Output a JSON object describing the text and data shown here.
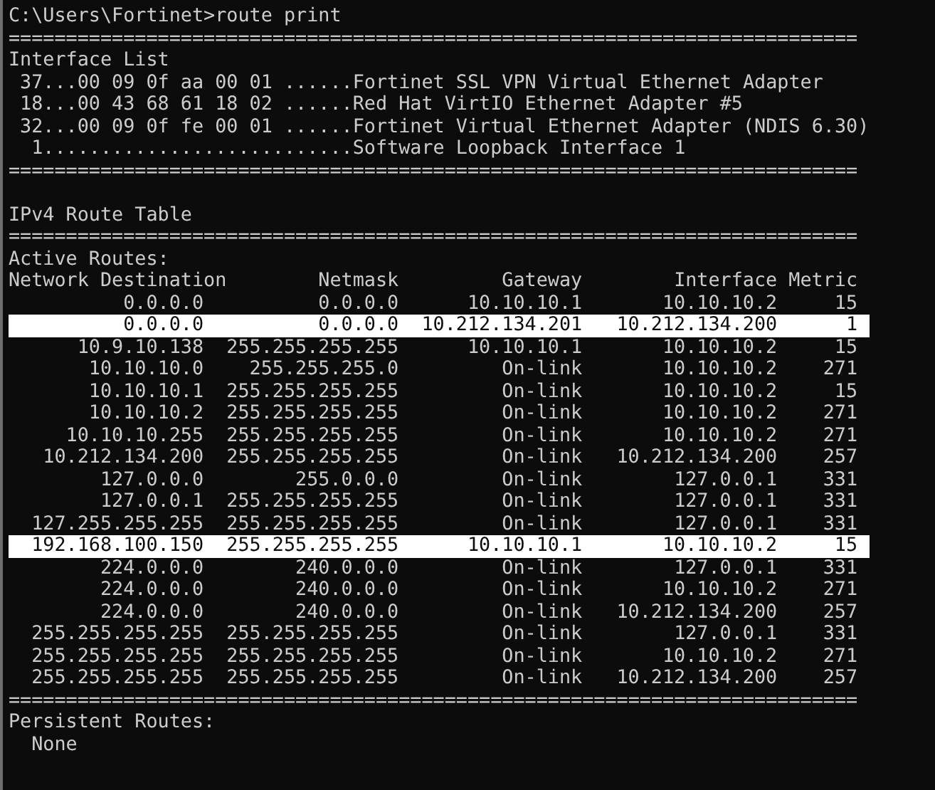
{
  "prompt": "C:\\Users\\Fortinet>route print",
  "interface_list": {
    "rule_top": "==========================================================================",
    "title": "Interface List",
    "interfaces": [
      " 37...00 09 0f aa 00 01 ......Fortinet SSL VPN Virtual Ethernet Adapter",
      " 18...00 43 68 61 18 02 ......Red Hat VirtIO Ethernet Adapter #5",
      " 32...00 09 0f fe 00 01 ......Fortinet Virtual Ethernet Adapter (NDIS 6.30)",
      "  1...........................Software Loopback Interface 1"
    ],
    "rule_bottom": "=========================================================================="
  },
  "route_table": {
    "title": "IPv4 Route Table",
    "rule_top": "==========================================================================",
    "subtitle": "Active Routes:",
    "columns": [
      "Network Destination",
      "Netmask",
      "Gateway",
      "Interface",
      "Metric"
    ],
    "routes": [
      {
        "destination": "0.0.0.0",
        "netmask": "0.0.0.0",
        "gateway": "10.10.10.1",
        "interface": "10.10.10.2",
        "metric": "15",
        "highlighted": false
      },
      {
        "destination": "0.0.0.0",
        "netmask": "0.0.0.0",
        "gateway": "10.212.134.201",
        "interface": "10.212.134.200",
        "metric": "1",
        "highlighted": true
      },
      {
        "destination": "10.9.10.138",
        "netmask": "255.255.255.255",
        "gateway": "10.10.10.1",
        "interface": "10.10.10.2",
        "metric": "15",
        "highlighted": false
      },
      {
        "destination": "10.10.10.0",
        "netmask": "255.255.255.0",
        "gateway": "On-link",
        "interface": "10.10.10.2",
        "metric": "271",
        "highlighted": false
      },
      {
        "destination": "10.10.10.1",
        "netmask": "255.255.255.255",
        "gateway": "On-link",
        "interface": "10.10.10.2",
        "metric": "15",
        "highlighted": false
      },
      {
        "destination": "10.10.10.2",
        "netmask": "255.255.255.255",
        "gateway": "On-link",
        "interface": "10.10.10.2",
        "metric": "271",
        "highlighted": false
      },
      {
        "destination": "10.10.10.255",
        "netmask": "255.255.255.255",
        "gateway": "On-link",
        "interface": "10.10.10.2",
        "metric": "271",
        "highlighted": false
      },
      {
        "destination": "10.212.134.200",
        "netmask": "255.255.255.255",
        "gateway": "On-link",
        "interface": "10.212.134.200",
        "metric": "257",
        "highlighted": false
      },
      {
        "destination": "127.0.0.0",
        "netmask": "255.0.0.0",
        "gateway": "On-link",
        "interface": "127.0.0.1",
        "metric": "331",
        "highlighted": false
      },
      {
        "destination": "127.0.0.1",
        "netmask": "255.255.255.255",
        "gateway": "On-link",
        "interface": "127.0.0.1",
        "metric": "331",
        "highlighted": false
      },
      {
        "destination": "127.255.255.255",
        "netmask": "255.255.255.255",
        "gateway": "On-link",
        "interface": "127.0.0.1",
        "metric": "331",
        "highlighted": false
      },
      {
        "destination": "192.168.100.150",
        "netmask": "255.255.255.255",
        "gateway": "10.10.10.1",
        "interface": "10.10.10.2",
        "metric": "15",
        "highlighted": true
      },
      {
        "destination": "224.0.0.0",
        "netmask": "240.0.0.0",
        "gateway": "On-link",
        "interface": "127.0.0.1",
        "metric": "331",
        "highlighted": false
      },
      {
        "destination": "224.0.0.0",
        "netmask": "240.0.0.0",
        "gateway": "On-link",
        "interface": "10.10.10.2",
        "metric": "271",
        "highlighted": false
      },
      {
        "destination": "224.0.0.0",
        "netmask": "240.0.0.0",
        "gateway": "On-link",
        "interface": "10.212.134.200",
        "metric": "257",
        "highlighted": false
      },
      {
        "destination": "255.255.255.255",
        "netmask": "255.255.255.255",
        "gateway": "On-link",
        "interface": "127.0.0.1",
        "metric": "331",
        "highlighted": false
      },
      {
        "destination": "255.255.255.255",
        "netmask": "255.255.255.255",
        "gateway": "On-link",
        "interface": "10.10.10.2",
        "metric": "271",
        "highlighted": false
      },
      {
        "destination": "255.255.255.255",
        "netmask": "255.255.255.255",
        "gateway": "On-link",
        "interface": "10.212.134.200",
        "metric": "257",
        "highlighted": false
      }
    ],
    "rule_bottom": "=========================================================================="
  },
  "persistent_routes": {
    "title": "Persistent Routes:",
    "value": "None"
  }
}
